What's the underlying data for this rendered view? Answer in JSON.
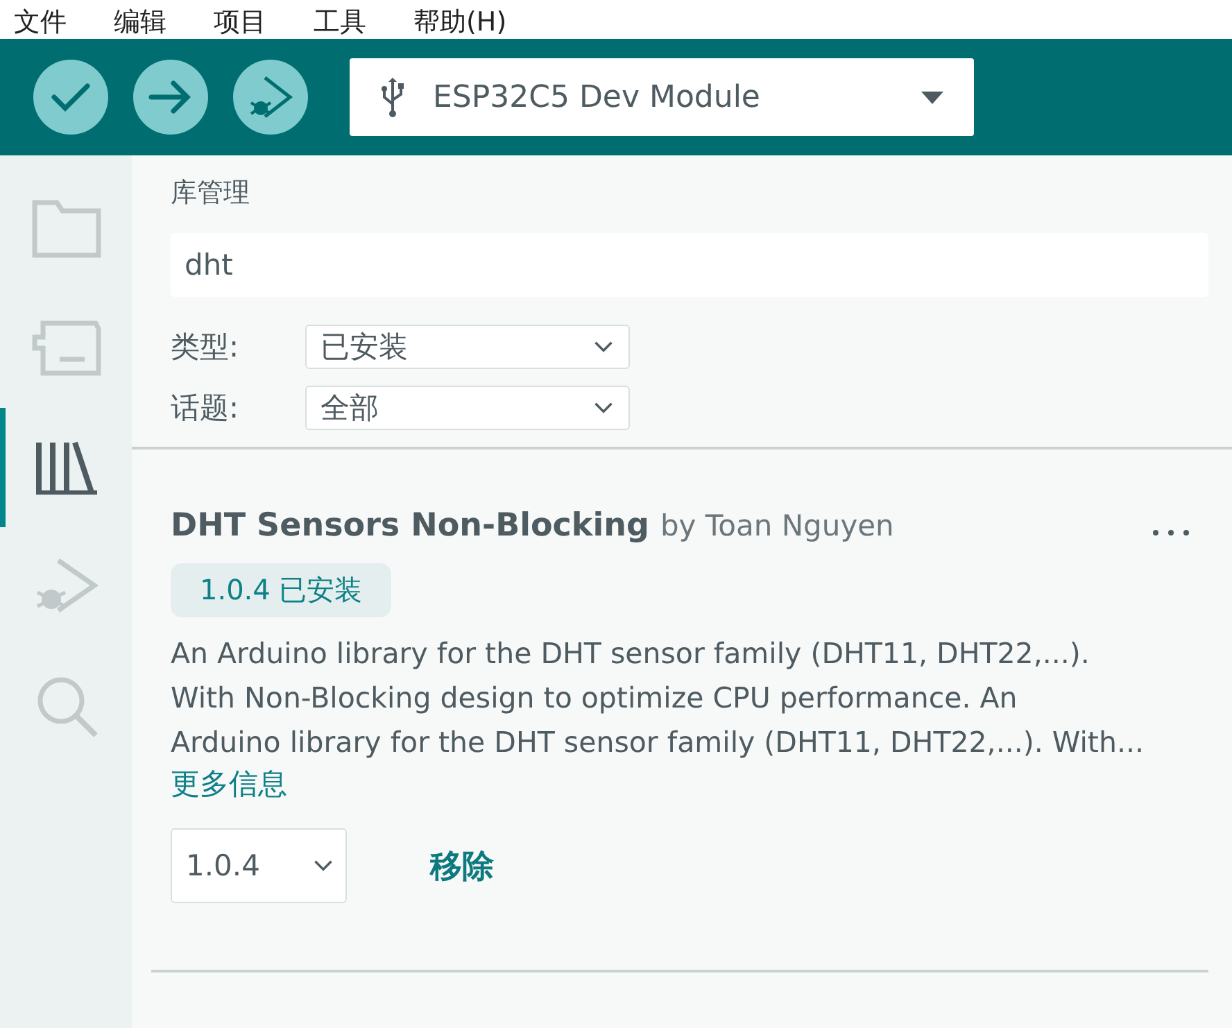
{
  "menu_bar": [
    "文件",
    "编辑",
    "项目",
    "工具",
    "帮助(H)"
  ],
  "toolbar": {
    "buttons": [
      {
        "kind": "verify"
      },
      {
        "kind": "upload"
      },
      {
        "kind": "debug"
      }
    ],
    "board": "ESP32C5 Dev Module"
  },
  "sidebar": {
    "items": [
      {
        "kind": "folder",
        "selected": false
      },
      {
        "kind": "board",
        "selected": false
      },
      {
        "kind": "library",
        "selected": true
      },
      {
        "kind": "debug",
        "selected": false
      },
      {
        "kind": "search",
        "selected": false
      }
    ]
  },
  "library_manager": {
    "title": "库管理",
    "search": {
      "value": "dht"
    },
    "filters": [
      {
        "label": "类型:",
        "value": "已安装"
      },
      {
        "label": "话题:",
        "value": "全部"
      }
    ],
    "results": [
      {
        "name": "DHT Sensors Non-Blocking",
        "author": "by Toan Nguyen",
        "badge": "1.0.4 已安装",
        "description_lines": [
          "An Arduino library for the DHT sensor family (DHT11, DHT22,...).",
          "With Non-Blocking design to optimize CPU performance. An",
          "Arduino library for the DHT sensor family (DHT11, DHT22,...). With..."
        ],
        "more_info": "更多信息",
        "version": "1.0.4",
        "action": "移除"
      }
    ]
  }
}
